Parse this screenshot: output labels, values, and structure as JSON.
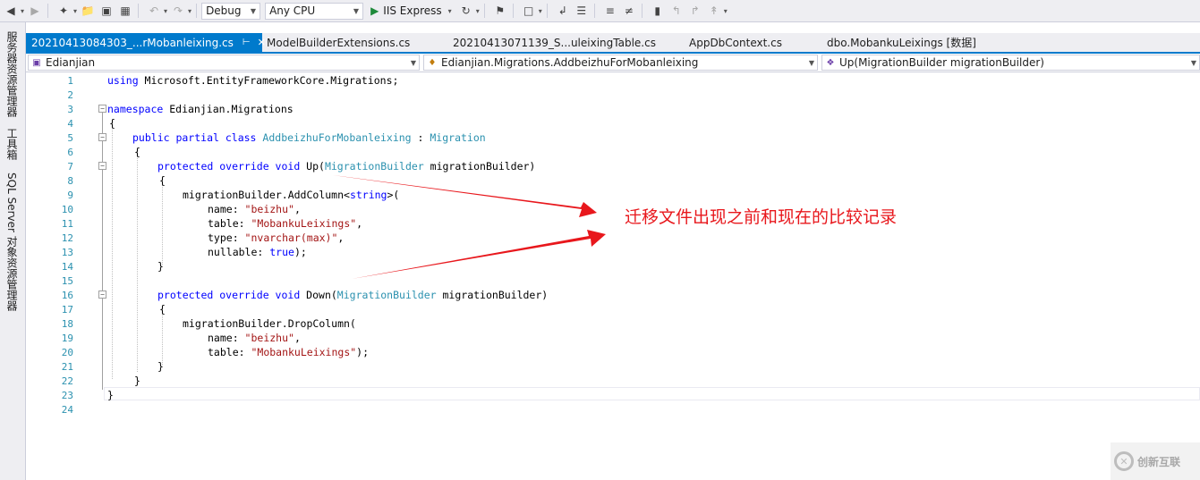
{
  "toolbar": {
    "config": "Debug",
    "platform": "Any CPU",
    "run_label": "IIS Express"
  },
  "sidebar": {
    "items": [
      "服务器资源管理器",
      "工具箱",
      "SQL Server 对象资源管理器"
    ]
  },
  "tabs": [
    {
      "label": "20210413084303_...rMobanleixing.cs",
      "active": true
    },
    {
      "label": "ModelBuilderExtensions.cs",
      "active": false
    },
    {
      "label": "20210413071139_S...uleixingTable.cs",
      "active": false
    },
    {
      "label": "AppDbContext.cs",
      "active": false
    },
    {
      "label": "dbo.MobankuLeixings [数据]",
      "active": false
    }
  ],
  "navbar": {
    "project": "Edianjian",
    "type": "Edianjian.Migrations.AddbeizhuForMobanleixing",
    "member": "Up(MigrationBuilder migrationBuilder)"
  },
  "line_numbers": [
    "1",
    "2",
    "3",
    "4",
    "5",
    "6",
    "7",
    "8",
    "9",
    "10",
    "11",
    "12",
    "13",
    "14",
    "15",
    "16",
    "17",
    "18",
    "19",
    "20",
    "21",
    "22",
    "23",
    "24"
  ],
  "code": {
    "l1": [
      "using",
      " Microsoft.EntityFrameworkCore.Migrations;"
    ],
    "l3": [
      "namespace",
      " Edianjian.Migrations"
    ],
    "l4": "{",
    "l5": [
      "public partial class",
      " ",
      "AddbeizhuForMobanleixing",
      " : ",
      "Migration"
    ],
    "l6": "{",
    "l7": [
      "protected override void",
      " Up(",
      "MigrationBuilder",
      " migrationBuilder)"
    ],
    "l8": "{",
    "l9": [
      "migrationBuilder.AddColumn<",
      "string",
      ">("
    ],
    "l10": [
      "name: ",
      "\"beizhu\"",
      ","
    ],
    "l11": [
      "table: ",
      "\"MobankuLeixings\"",
      ","
    ],
    "l12": [
      "type: ",
      "\"nvarchar(max)\"",
      ","
    ],
    "l13": [
      "nullable: ",
      "true",
      ");"
    ],
    "l14": "}",
    "l16": [
      "protected override void",
      " Down(",
      "MigrationBuilder",
      " migrationBuilder)"
    ],
    "l17": "{",
    "l18": "migrationBuilder.DropColumn(",
    "l19": [
      "name: ",
      "\"beizhu\"",
      ","
    ],
    "l20": [
      "table: ",
      "\"MobankuLeixings\"",
      ");"
    ],
    "l21": "}",
    "l22": "}",
    "l23": "}"
  },
  "annotation": "迁移文件出现之前和现在的比较记录",
  "watermark": "创新互联",
  "colors": {
    "accent": "#007acc",
    "annotation": "#e8171c",
    "keyword": "#0000ff",
    "type": "#2b91af",
    "string": "#a31515"
  }
}
